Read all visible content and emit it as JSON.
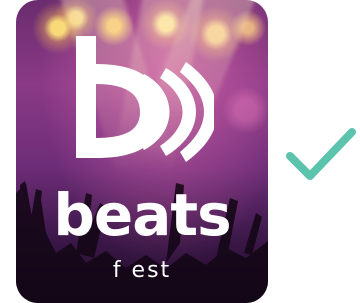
{
  "logo": {
    "name": "beats",
    "tagline": "f est"
  },
  "icons": {
    "logo_mark": "play-waves-logo-icon",
    "status": "checkmark-icon"
  },
  "colors": {
    "check": "#5cc3ad",
    "logo_text": "#ffffff"
  }
}
